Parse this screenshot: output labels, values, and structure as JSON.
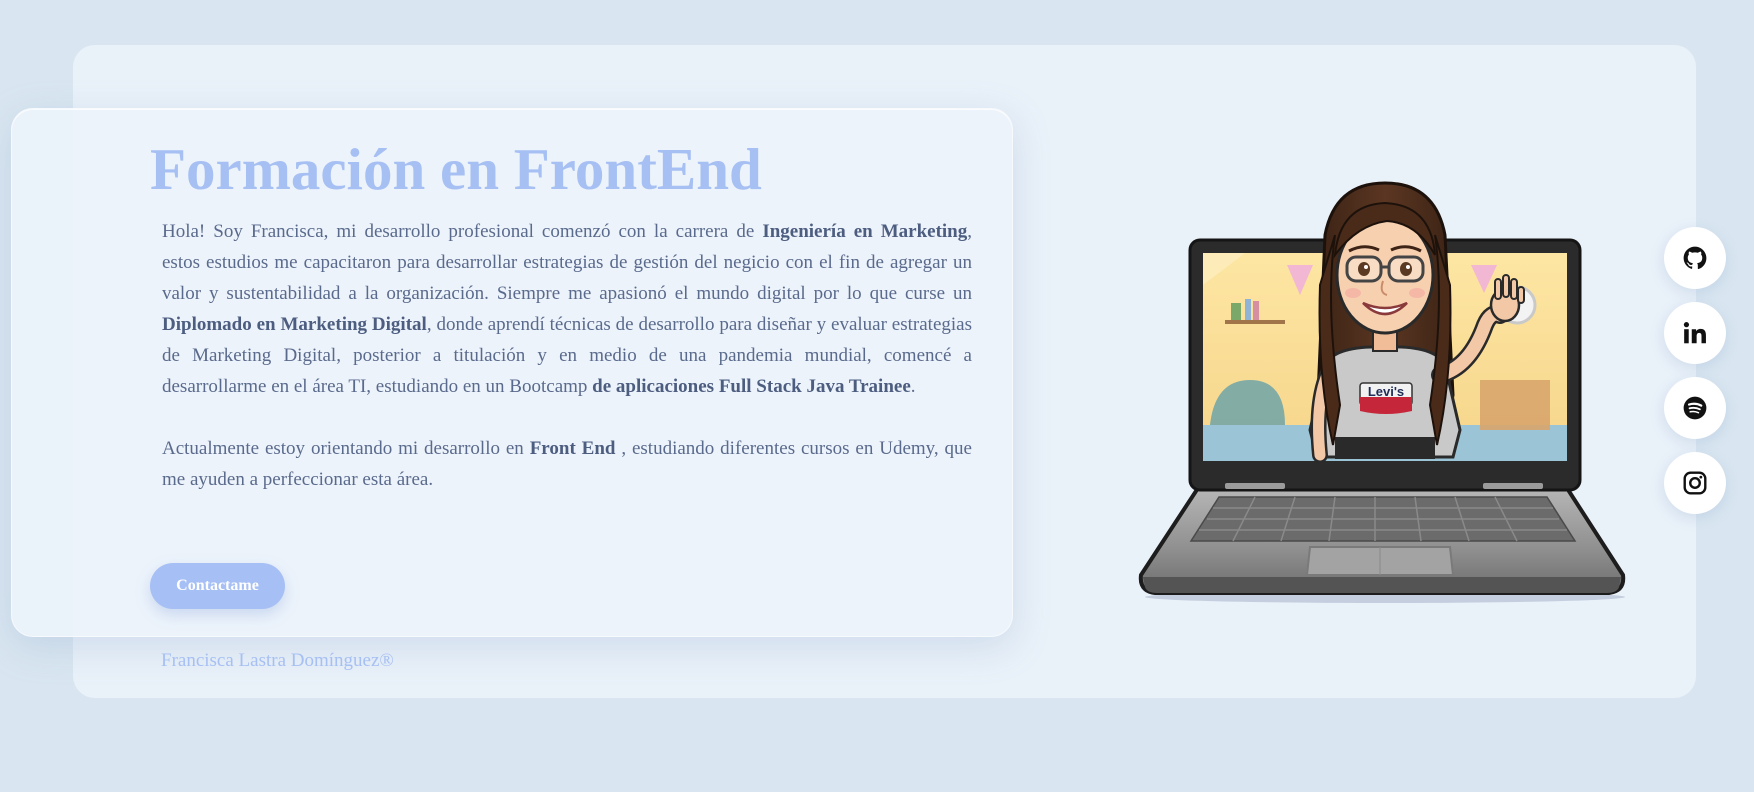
{
  "hero": {
    "title": "Formación en FrontEnd",
    "paragraph1": {
      "t1": "Hola! Soy Francisca, mi desarrollo profesional comenzó con la carrera de ",
      "b1": "Ingeniería en Marketing",
      "t2": ", estos estudios me capacitaron para desarrollar estrategias de gestión del negicio con el fin de agregar un valor y sustentabilidad a la organización. Siempre me apasionó el mundo digital por lo que curse un ",
      "b2": "Diplomado en Marketing Digital",
      "t3": ", donde aprendí técnicas de desarrollo para diseñar y evaluar estrategias de Marketing Digital, posterior a titulación y en medio de una pandemia mundial, comencé a desarrollarme en el área TI, estudiando en un Bootcamp ",
      "b3": "de aplicaciones Full Stack Java Trainee",
      "t4": "."
    },
    "paragraph2": {
      "t1": "Actualmente estoy orientando mi desarrollo en ",
      "b1": "Front End",
      "t2": " , estudiando diferentes cursos en Udemy, que me ayuden a perfeccionar esta área."
    },
    "contact_button": "Contactame"
  },
  "footer": {
    "credit": "Francisca Lastra Domínguez®"
  },
  "illustration": {
    "shirt_logo": "Levi's"
  },
  "social": [
    {
      "name": "GitHub",
      "icon": "github-icon"
    },
    {
      "name": "LinkedIn",
      "icon": "linkedin-icon"
    },
    {
      "name": "Spotify",
      "icon": "spotify-icon"
    },
    {
      "name": "Instagram",
      "icon": "instagram-icon"
    }
  ],
  "colors": {
    "background": "#d9e6f1",
    "card": "#e9f1f9",
    "accent": "#a7c0f3",
    "body_text": "#5a6a8c"
  }
}
